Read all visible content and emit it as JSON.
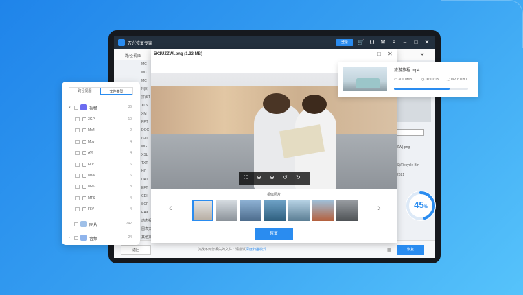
{
  "window": {
    "title": "万兴恢复专家",
    "login": "登录"
  },
  "subbar": {
    "path_view": "路径视图"
  },
  "file_list": [
    "MC",
    "MC",
    "MC",
    "N(E)",
    "拼(ST",
    "XLS",
    "XM",
    "PPT",
    "DOC",
    "ISO",
    "MG",
    "XSL",
    "TXT",
    "HC",
    "DAT",
    "EFT",
    "CDI",
    "SCF",
    "EAX",
    "动态视",
    "图表文",
    "其他文"
  ],
  "right_panel": {
    "name": "ZW).png",
    "loc": "S)/Recycle Bin",
    "year": "2021"
  },
  "status": {
    "back": "返回",
    "hint": "仍找不到您丢失的文件？请尝试",
    "hint_link": "深度扫描模式",
    "recover": "恢复"
  },
  "preview": {
    "title": "5K1UZZWi.png (1.33 MB)",
    "similar_label": "相似照片",
    "recover": "恢复"
  },
  "panel": {
    "tabs": [
      "路径视图",
      "文件类型"
    ],
    "video": {
      "name": "视频",
      "count": "36"
    },
    "items": [
      {
        "name": "3GP",
        "count": "10"
      },
      {
        "name": "Mp4",
        "count": "2"
      },
      {
        "name": "Mov",
        "count": "4"
      },
      {
        "name": "AVI",
        "count": "4"
      },
      {
        "name": "FLV",
        "count": "6"
      },
      {
        "name": "MKV",
        "count": "6"
      },
      {
        "name": "MPG",
        "count": "8"
      },
      {
        "name": "MTS",
        "count": "4"
      },
      {
        "name": "FLV",
        "count": "4"
      }
    ],
    "photo": {
      "name": "图片",
      "count": "242"
    },
    "audio": {
      "name": "音频",
      "count": "24"
    }
  },
  "file_card": {
    "name": "旅游旅程.mp4",
    "size": "300.0MB",
    "duration": "00:00:15",
    "resolution": "1920*1080",
    "progress": 0.75
  },
  "gauge": {
    "value": "45",
    "unit": "%",
    "fraction": 0.45
  }
}
